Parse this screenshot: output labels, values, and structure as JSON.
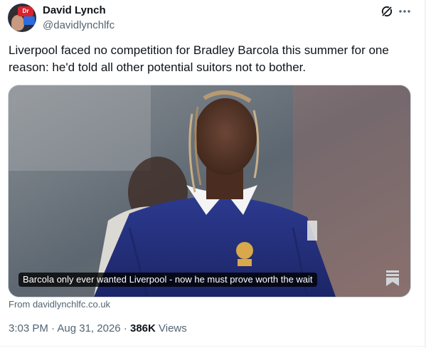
{
  "author": {
    "name": "David Lynch",
    "handle": "@davidlynchlfc",
    "avatar_badge": "Dr"
  },
  "actions": {
    "grok_icon": "grok-slash-icon",
    "more_icon": "more-dots-icon",
    "bookmark_icon": "bookmark-icon"
  },
  "tweet": {
    "text": "Liverpool faced no competition for Bradley Barcola this summer for one reason: he'd told all other potential suitors not to bother."
  },
  "card": {
    "caption": "Barcola only ever wanted Liverpool - now he must prove worth the wait",
    "source": "From davidlynchlfc.co.uk"
  },
  "meta": {
    "time": "3:03 PM",
    "separator": "·",
    "date": "Aug 31, 2026",
    "views_count": "386K",
    "views_label": "Views"
  },
  "colors": {
    "text_primary": "#0f1419",
    "text_secondary": "#536471",
    "border": "#cfd9de",
    "jersey_blue": "#25307a"
  }
}
